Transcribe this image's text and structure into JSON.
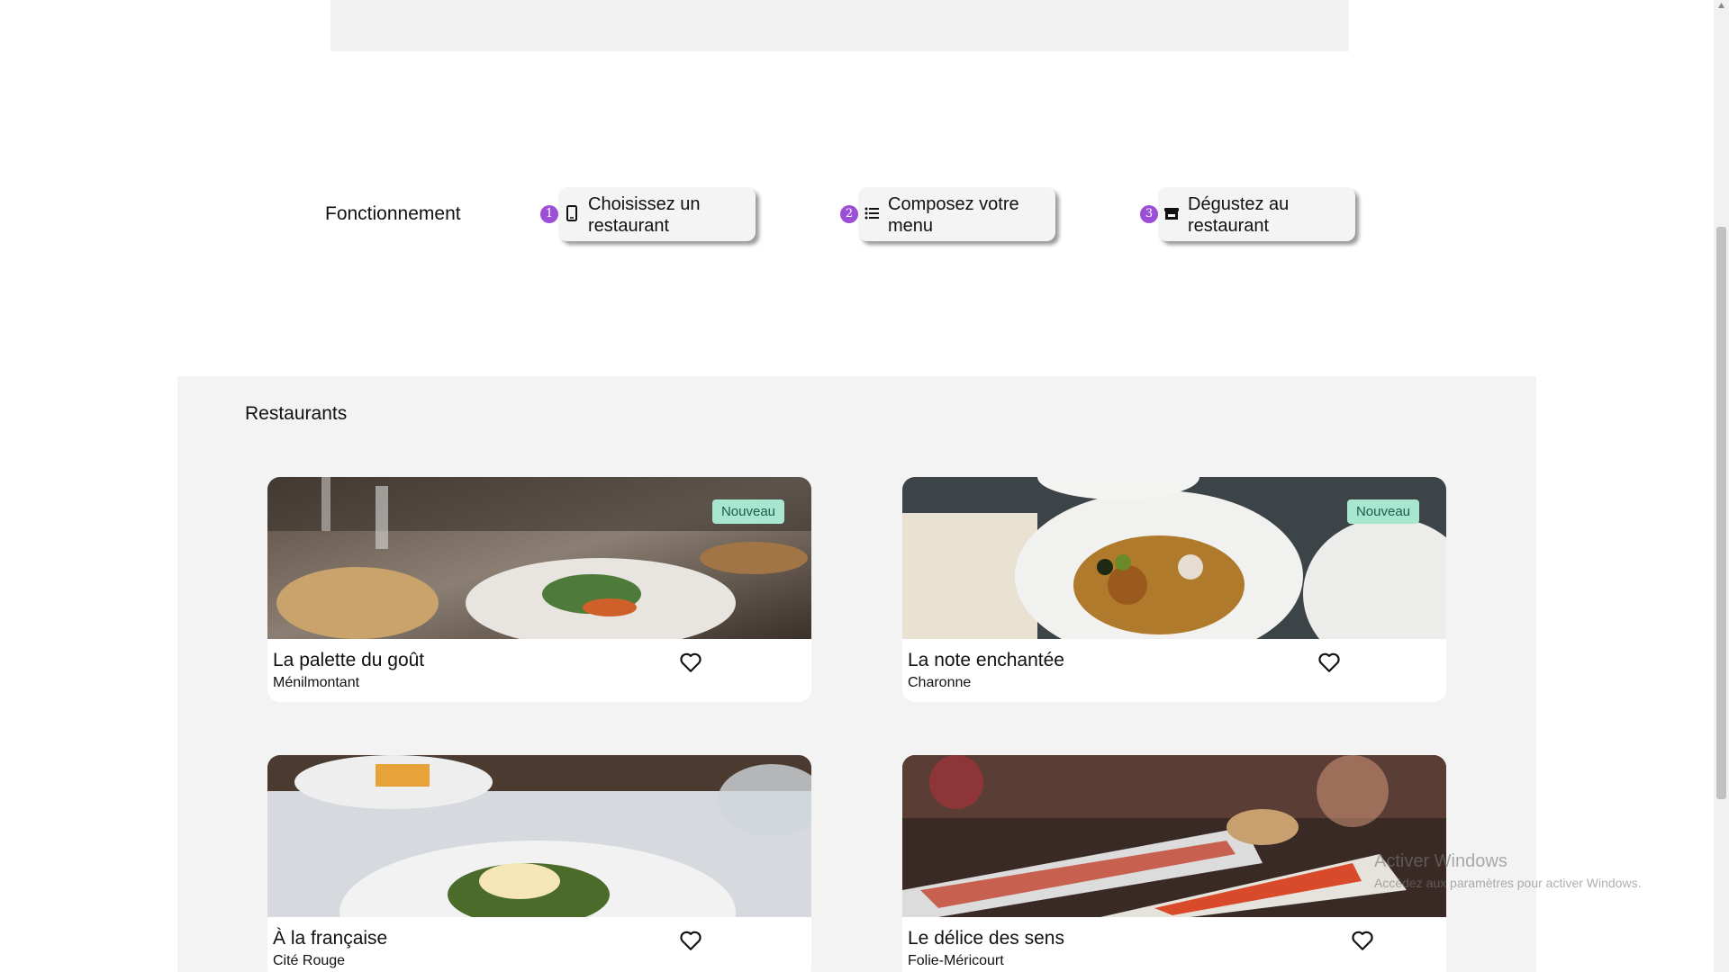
{
  "how_it_works": {
    "title": "Fonctionnement",
    "steps": [
      {
        "number": "1",
        "label": "Choisissez un restaurant",
        "icon": "mobile-phone-icon"
      },
      {
        "number": "2",
        "label": "Composez votre menu",
        "icon": "list-icon"
      },
      {
        "number": "3",
        "label": "Dégustez au restaurant",
        "icon": "store-icon"
      }
    ]
  },
  "restaurants": {
    "title": "Restaurants",
    "items": [
      {
        "name": "La palette du goût",
        "place": "Ménilmontant",
        "badge": "Nouveau"
      },
      {
        "name": "La note enchantée",
        "place": "Charonne",
        "badge": "Nouveau"
      },
      {
        "name": "À la française",
        "place": "Cité Rouge",
        "badge": ""
      },
      {
        "name": "Le délice des sens",
        "place": "Folie-Méricourt",
        "badge": ""
      }
    ]
  },
  "watermark": {
    "title": "Activer Windows",
    "subtitle": "Accédez aux paramètres pour activer Windows."
  },
  "colors": {
    "accent": "#9b4fd6",
    "badge_bg": "#a8e6cf",
    "section_bg": "#f3f3f3"
  }
}
